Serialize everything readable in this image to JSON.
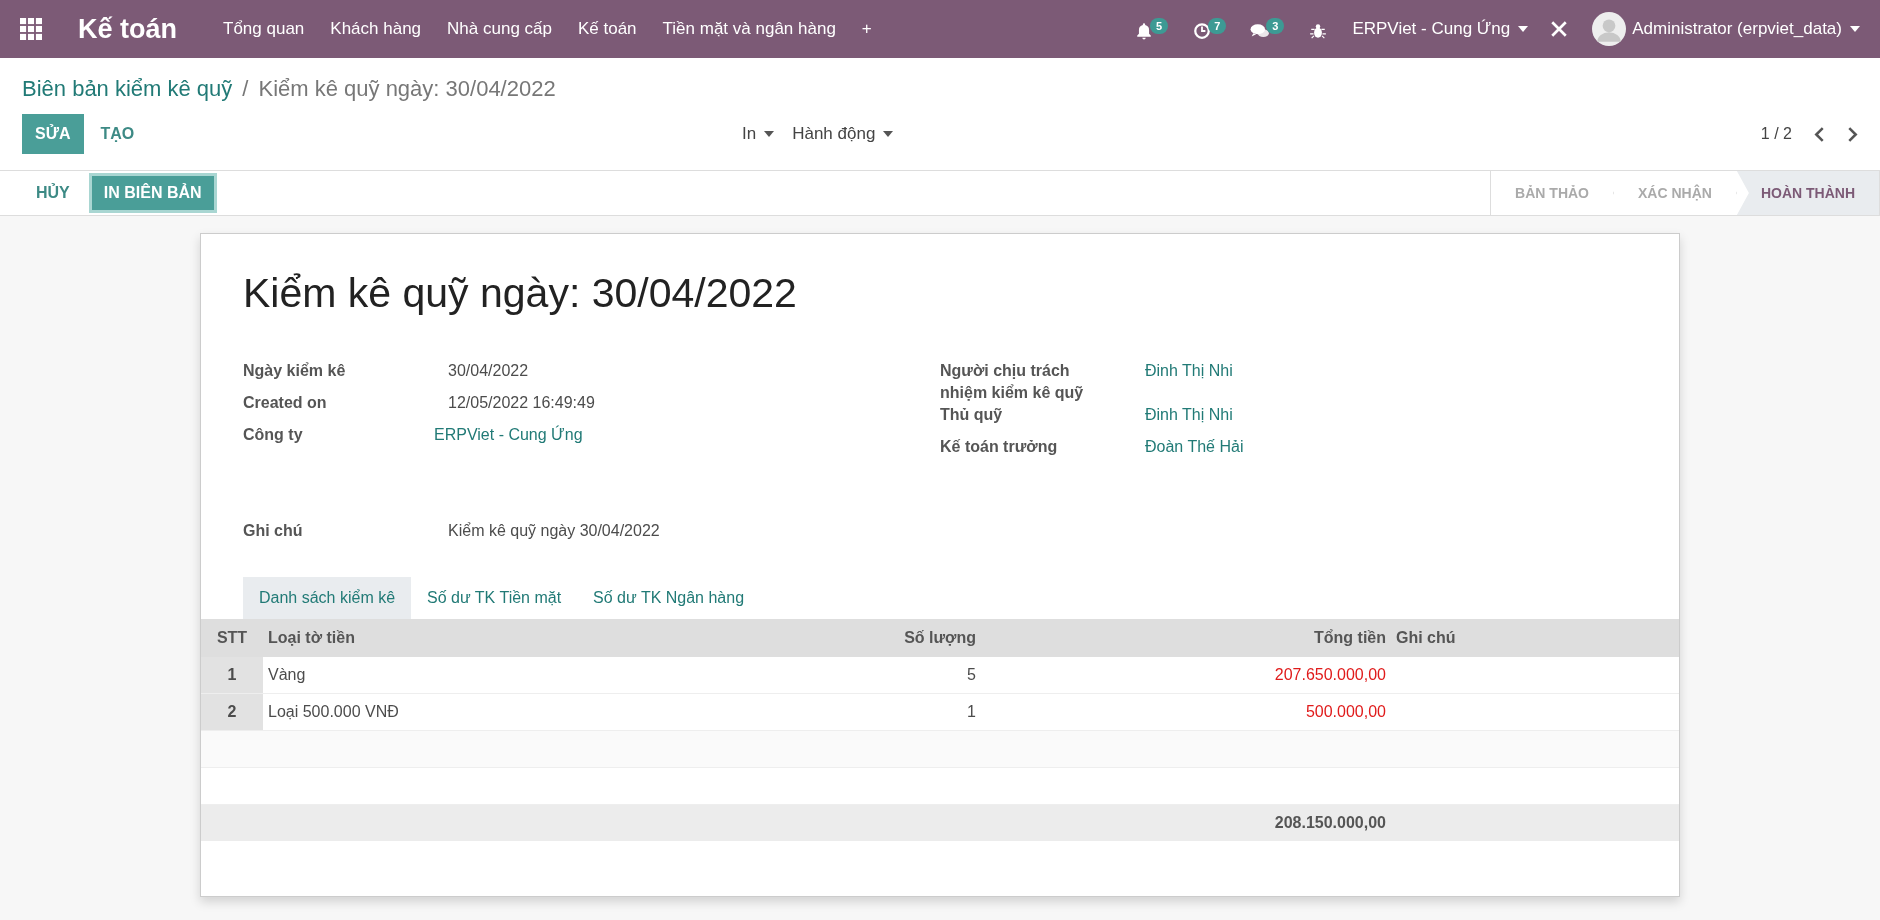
{
  "navbar": {
    "app_name": "Kế toán",
    "menu": [
      "Tổng quan",
      "Khách hàng",
      "Nhà cung cấp",
      "Kế toán",
      "Tiền mặt và ngân hàng",
      "+"
    ],
    "systray": [
      {
        "kind": "bell",
        "count": "5"
      },
      {
        "kind": "clock",
        "count": "7"
      },
      {
        "kind": "chat",
        "count": "3"
      },
      {
        "kind": "bug"
      }
    ],
    "company": "ERPViet - Cung Ứng",
    "user": "Administrator (erpviet_data)"
  },
  "breadcrumb": {
    "parent": "Biên bản kiểm kê quỹ",
    "separator": "/",
    "current": "Kiểm kê quỹ ngày: 30/04/2022"
  },
  "control_buttons": [
    "SỬA",
    "TẠO"
  ],
  "dropdowns": [
    "In",
    "Hành động"
  ],
  "pager": "1 / 2",
  "status_bar": {
    "buttons": [
      {
        "label": "HỦY",
        "kind": "link"
      },
      {
        "label": "IN BIÊN BẢN",
        "kind": "primary"
      }
    ],
    "stages": [
      {
        "label": "BẢN THẢO",
        "selected": false
      },
      {
        "label": "XÁC NHẬN",
        "selected": false
      },
      {
        "label": "HOÀN THÀNH",
        "selected": true
      }
    ]
  },
  "form": {
    "title": "Kiểm kê quỹ ngày: 30/04/2022",
    "left_fields": [
      {
        "label": "Ngày kiểm kê",
        "value": "30/04/2022",
        "kind": "text"
      },
      {
        "label": "Created on",
        "value": "12/05/2022 16:49:49",
        "kind": "text"
      },
      {
        "label": "Công ty",
        "value": "ERPViet - Cung Ứng",
        "kind": "link"
      }
    ],
    "right_fields": [
      {
        "label": "Người chịu trách nhiệm kiểm kê quỹ",
        "value": "Đinh Thị Nhi",
        "kind": "link"
      },
      {
        "label": "Thủ quỹ",
        "value": "Đinh Thị Nhi",
        "kind": "link"
      },
      {
        "label": "Kế toán trưởng",
        "value": "Đoàn Thế Hải",
        "kind": "link"
      }
    ],
    "note": {
      "label": "Ghi chú",
      "value": "Kiểm kê quỹ ngày 30/04/2022"
    }
  },
  "tabs": [
    {
      "label": "Danh sách kiểm kê",
      "selected": true
    },
    {
      "label": "Số dư TK Tiền mặt",
      "selected": false
    },
    {
      "label": "Số dư TK Ngân hàng",
      "selected": false
    }
  ],
  "table": {
    "columns": [
      "STT",
      "Loại tờ tiền",
      "Số lượng",
      "Tổng tiền",
      "Ghi chú"
    ],
    "rows": [
      {
        "stt": "1",
        "type": "Vàng",
        "quantity": "5",
        "total": "207.650.000,00"
      },
      {
        "stt": "2",
        "type": "Loại 500.000 VNĐ",
        "quantity": "1",
        "total": "500.000,00"
      }
    ],
    "grand_total": "208.150.000,00"
  }
}
